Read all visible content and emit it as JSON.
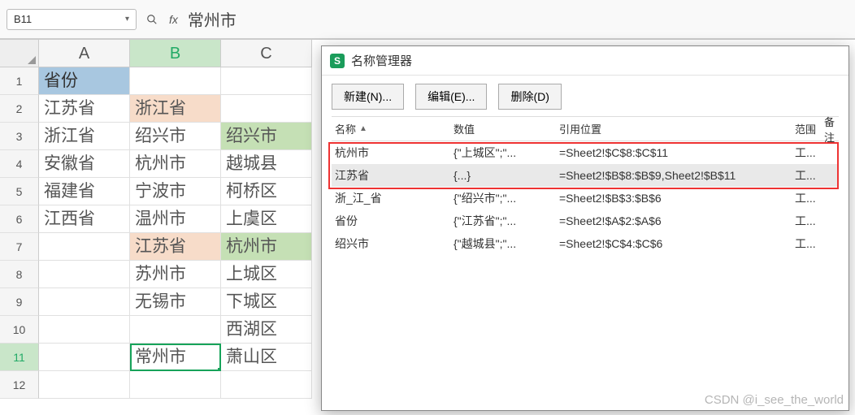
{
  "formula_bar": {
    "name_box": "B11",
    "fx_label": "fx",
    "formula": "常州市"
  },
  "sheet": {
    "columns": [
      "A",
      "B",
      "C"
    ],
    "active_cell": "B11",
    "rows": [
      {
        "n": "1",
        "A": "省份",
        "B": "",
        "C": "",
        "A_cls": "blue-sel bold"
      },
      {
        "n": "2",
        "A": "江苏省",
        "B": "浙江省",
        "C": "",
        "B_cls": "peach"
      },
      {
        "n": "3",
        "A": "浙江省",
        "B": "绍兴市",
        "C": "绍兴市",
        "C_cls": "green"
      },
      {
        "n": "4",
        "A": "安徽省",
        "B": "杭州市",
        "C": "越城县"
      },
      {
        "n": "5",
        "A": "福建省",
        "B": "宁波市",
        "C": "柯桥区"
      },
      {
        "n": "6",
        "A": "江西省",
        "B": "温州市",
        "C": "上虞区"
      },
      {
        "n": "7",
        "A": "",
        "B": "江苏省",
        "C": "杭州市",
        "B_cls": "peach",
        "C_cls": "green"
      },
      {
        "n": "8",
        "A": "",
        "B": "苏州市",
        "C": "上城区"
      },
      {
        "n": "9",
        "A": "",
        "B": "无锡市",
        "C": "下城区"
      },
      {
        "n": "10",
        "A": "",
        "B": "",
        "C": "西湖区"
      },
      {
        "n": "11",
        "A": "",
        "B": "常州市",
        "C": "萧山区",
        "B_cls": "active",
        "row_active": true
      },
      {
        "n": "12",
        "A": "",
        "B": "",
        "C": ""
      }
    ]
  },
  "dialog": {
    "title": "名称管理器",
    "buttons": {
      "new": "新建(N)...",
      "edit": "编辑(E)...",
      "delete": "删除(D)"
    },
    "headers": {
      "name": "名称",
      "value": "数值",
      "ref": "引用位置",
      "scope": "范围",
      "note": "备注"
    },
    "items": [
      {
        "name": "杭州市",
        "value": "{\"上城区\";\"...",
        "ref": "=Sheet2!$C$8:$C$11",
        "scope": "工...",
        "selected": false
      },
      {
        "name": "江苏省",
        "value": "{...}",
        "ref": "=Sheet2!$B$8:$B$9,Sheet2!$B$11",
        "scope": "工...",
        "selected": true
      },
      {
        "name": "浙_江_省",
        "value": "{\"绍兴市\";\"...",
        "ref": "=Sheet2!$B$3:$B$6",
        "scope": "工...",
        "selected": false
      },
      {
        "name": "省份",
        "value": "{\"江苏省\";\"...",
        "ref": "=Sheet2!$A$2:$A$6",
        "scope": "工...",
        "selected": false
      },
      {
        "name": "绍兴市",
        "value": "{\"越城县\";\"...",
        "ref": "=Sheet2!$C$4:$C$6",
        "scope": "工...",
        "selected": false
      }
    ]
  },
  "watermark": "CSDN @i_see_the_world"
}
